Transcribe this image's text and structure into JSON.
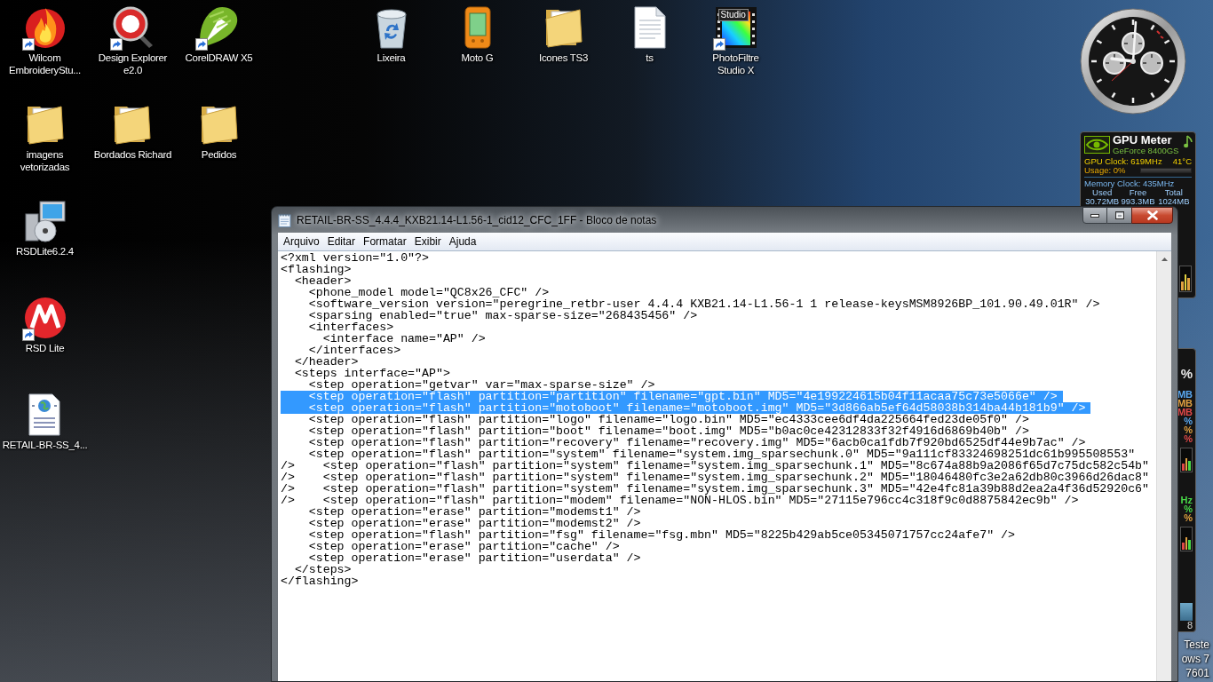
{
  "desktop_icons": [
    {
      "label": "Wilcom EmbroideryStu...",
      "kind": "flame",
      "shortcut": true
    },
    {
      "label": "Design Explorer e2.0",
      "kind": "magnifier",
      "shortcut": true
    },
    {
      "label": "CorelDRAW X5",
      "kind": "pen",
      "shortcut": true
    },
    {
      "label": "Lixeira",
      "kind": "bin",
      "shortcut": false
    },
    {
      "label": "Moto G",
      "kind": "phone",
      "shortcut": false
    },
    {
      "label": "Icones TS3",
      "kind": "folder",
      "shortcut": false
    },
    {
      "label": "ts",
      "kind": "textfile",
      "shortcut": false
    },
    {
      "label": "PhotoFiltre Studio X",
      "kind": "studio",
      "shortcut": true,
      "caption": "Studio"
    },
    {
      "label": "imagens vetorizadas",
      "kind": "folder",
      "shortcut": false
    },
    {
      "label": "Bordados Richard",
      "kind": "folder",
      "shortcut": false
    },
    {
      "label": "Pedidos",
      "kind": "folder",
      "shortcut": false
    },
    {
      "label": "RSDLite6.2.4",
      "kind": "installer",
      "shortcut": false
    },
    {
      "label": "RSD Lite",
      "kind": "emblem",
      "shortcut": true
    },
    {
      "label": "RETAIL-BR-SS_4...",
      "kind": "webfile",
      "shortcut": false
    }
  ],
  "gpu_meter": {
    "title": "GPU Meter",
    "model": "GeForce 8400GS",
    "gpu_clock": "GPU Clock: 619MHz",
    "temperature": "41°C",
    "usage": "Usage: 0%",
    "memory_clock": "Memory Clock: 435MHz",
    "memory_columns": [
      {
        "heading": "Used",
        "value": "30.72MB"
      },
      {
        "heading": "Free",
        "value": "993.3MB"
      },
      {
        "heading": "Total",
        "value": "1024MB"
      }
    ]
  },
  "side_gadget": {
    "sections": [
      {
        "readings": [
          {
            "text": "%",
            "color": "#e8e8e8"
          }
        ]
      },
      {
        "readings": [
          {
            "text": "MB",
            "color": "#5aa8f0"
          },
          {
            "text": "MB",
            "color": "#e0a040"
          },
          {
            "text": "MB",
            "color": "#e04848"
          },
          {
            "text": "%",
            "color": "#5aa8f0"
          },
          {
            "text": "%",
            "color": "#e0a040"
          },
          {
            "text": "%",
            "color": "#e04848"
          }
        ]
      },
      {
        "readings": [
          {
            "text": "Hz",
            "color": "#48d848"
          },
          {
            "text": "%",
            "color": "#48d848"
          },
          {
            "text": "%",
            "color": "#e0a040"
          }
        ]
      }
    ],
    "footer": "8"
  },
  "notepad": {
    "title": "RETAIL-BR-SS_4.4.4_KXB21.14-L1.56-1_cid12_CFC_1FF - Bloco de notas",
    "menu": [
      "Arquivo",
      "Editar",
      "Formatar",
      "Exibir",
      "Ajuda"
    ],
    "lines": [
      {
        "text": "<?xml version=\"1.0\"?>",
        "selected": false
      },
      {
        "text": "<flashing>",
        "selected": false
      },
      {
        "text": "  <header>",
        "selected": false
      },
      {
        "text": "    <phone_model model=\"QC8x26_CFC\" />",
        "selected": false
      },
      {
        "text": "    <software_version version=\"peregrine_retbr-user 4.4.4 KXB21.14-L1.56-1 1 release-keysMSM8926BP_101.90.49.01R\" />",
        "selected": false
      },
      {
        "text": "    <sparsing enabled=\"true\" max-sparse-size=\"268435456\" />",
        "selected": false
      },
      {
        "text": "    <interfaces>",
        "selected": false
      },
      {
        "text": "      <interface name=\"AP\" />",
        "selected": false
      },
      {
        "text": "    </interfaces>",
        "selected": false
      },
      {
        "text": "  </header>",
        "selected": false
      },
      {
        "text": "  <steps interface=\"AP\">",
        "selected": false
      },
      {
        "text": "    <step operation=\"getvar\" var=\"max-sparse-size\" />",
        "selected": false
      },
      {
        "text": "    <step operation=\"flash\" partition=\"partition\" filename=\"gpt.bin\" MD5=\"4e199224615b04f11acaa75c73e5066e\" />",
        "selected": true
      },
      {
        "text": "    <step operation=\"flash\" partition=\"motoboot\" filename=\"motoboot.img\" MD5=\"3d866ab5ef64d58038b314ba44b181b9\" />",
        "selected": true
      },
      {
        "text": "    <step operation=\"flash\" partition=\"logo\" filename=\"logo.bin\" MD5=\"ec4333cee6df4da225664fed23de05f0\" />",
        "selected": false
      },
      {
        "text": "    <step operation=\"flash\" partition=\"boot\" filename=\"boot.img\" MD5=\"b0ac0ce42312833f32f4916d6869b40b\" />",
        "selected": false
      },
      {
        "text": "    <step operation=\"flash\" partition=\"recovery\" filename=\"recovery.img\" MD5=\"6acb0ca1fdb7f920bd6525df44e9b7ac\" />",
        "selected": false
      },
      {
        "text": "    <step operation=\"flash\" partition=\"system\" filename=\"system.img_sparsechunk.0\" MD5=\"9a111cf83324698251dc61b995508553\"",
        "selected": false
      },
      {
        "text": "/>    <step operation=\"flash\" partition=\"system\" filename=\"system.img_sparsechunk.1\" MD5=\"8c674a88b9a2086f65d7c75dc582c54b\"",
        "selected": false
      },
      {
        "text": "/>    <step operation=\"flash\" partition=\"system\" filename=\"system.img_sparsechunk.2\" MD5=\"18046480fc3e2a62db80c3966d26dac8\"",
        "selected": false
      },
      {
        "text": "/>    <step operation=\"flash\" partition=\"system\" filename=\"system.img_sparsechunk.3\" MD5=\"42e4fc81a39b88d2ea2a4f36d52920c6\"",
        "selected": false
      },
      {
        "text": "/>    <step operation=\"flash\" partition=\"modem\" filename=\"NON-HLOS.bin\" MD5=\"27115e796cc4c318f9c0d8875842ec9b\" />",
        "selected": false
      },
      {
        "text": "    <step operation=\"erase\" partition=\"modemst1\" />",
        "selected": false
      },
      {
        "text": "    <step operation=\"erase\" partition=\"modemst2\" />",
        "selected": false
      },
      {
        "text": "    <step operation=\"flash\" partition=\"fsg\" filename=\"fsg.mbn\" MD5=\"8225b429ab5ce05345071757cc24afe7\" />",
        "selected": false
      },
      {
        "text": "    <step operation=\"erase\" partition=\"cache\" />",
        "selected": false
      },
      {
        "text": "    <step operation=\"erase\" partition=\"userdata\" />",
        "selected": false
      },
      {
        "text": "  </steps>",
        "selected": false
      },
      {
        "text": "</flashing>",
        "selected": false
      }
    ]
  },
  "desktop_notice": [
    "Teste",
    "ows 7",
    "7601"
  ]
}
